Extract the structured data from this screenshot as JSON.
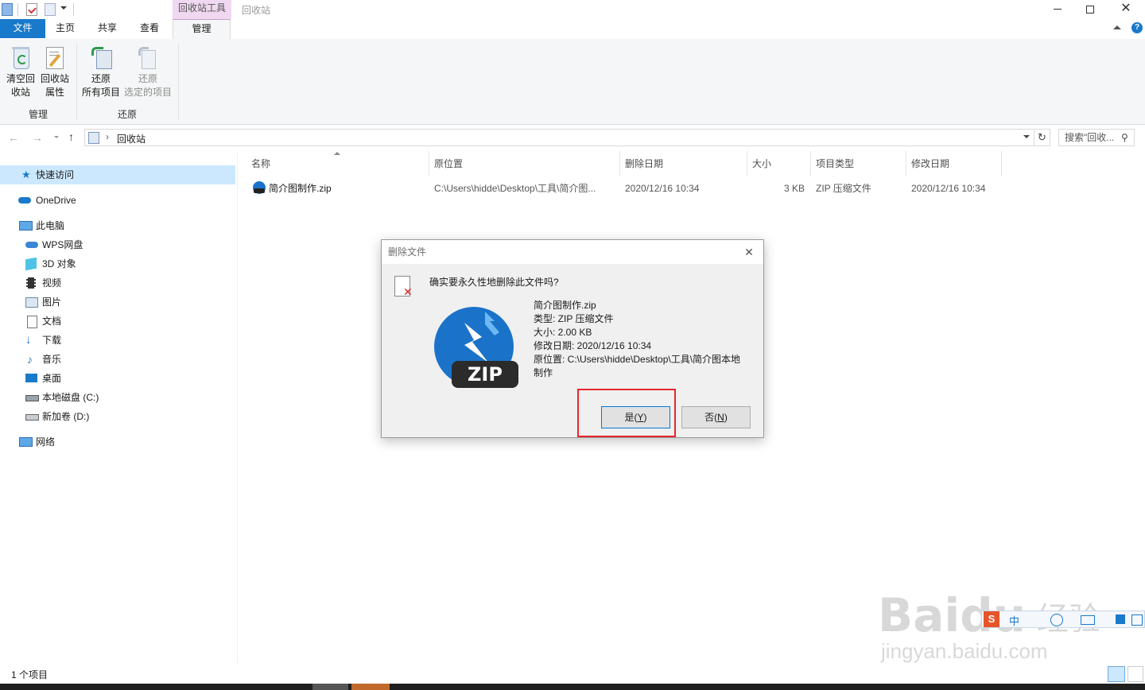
{
  "window": {
    "title": "回收站",
    "context_group": "回收站工具"
  },
  "ribbon": {
    "tabs": [
      "文件",
      "主页",
      "共享",
      "查看",
      "管理"
    ],
    "buttons": {
      "empty_bin": [
        "清空回",
        "收站"
      ],
      "bin_props": [
        "回收站",
        "属性"
      ],
      "restore_all": [
        "还原",
        "所有项目"
      ],
      "restore_selected": [
        "还原",
        "选定的项目"
      ]
    },
    "groups": {
      "manage": "管理",
      "restore": "还原"
    }
  },
  "address": {
    "path": "回收站",
    "search_placeholder": "搜索\"回收..."
  },
  "nav": {
    "quick_access": "快速访问",
    "onedrive": "OneDrive",
    "this_pc": "此电脑",
    "children": [
      "WPS网盘",
      "3D 对象",
      "视频",
      "图片",
      "文档",
      "下载",
      "音乐",
      "桌面",
      "本地磁盘 (C:)",
      "新加卷 (D:)"
    ],
    "network": "网络"
  },
  "list": {
    "columns": [
      "名称",
      "原位置",
      "删除日期",
      "大小",
      "项目类型",
      "修改日期"
    ],
    "rows": [
      {
        "name": "简介图制作.zip",
        "location": "C:\\Users\\hidde\\Desktop\\工具\\简介图...",
        "deleted": "2020/12/16 10:34",
        "size": "3 KB",
        "type": "ZIP 压缩文件",
        "modified": "2020/12/16 10:34"
      }
    ]
  },
  "dialog": {
    "title": "删除文件",
    "question": "确实要永久性地删除此文件吗?",
    "file_name": "简介图制作.zip",
    "type": "类型: ZIP 压缩文件",
    "size": "大小: 2.00 KB",
    "modified": "修改日期: 2020/12/16 10:34",
    "location_line1": "原位置: C:\\Users\\hidde\\Desktop\\工具\\简介图本地",
    "location_line2": "制作",
    "zip_label": "ZIP",
    "yes_prefix": "是(",
    "yes_key": "Y",
    "no_prefix": "否(",
    "no_key": "N",
    "suffix": ")"
  },
  "status": {
    "count": "1 个项目"
  },
  "watermark": {
    "brand": "Baidu",
    "cn": "经验",
    "url": "jingyan.baidu.com"
  },
  "colors": {
    "accent": "#1979ca",
    "context_tab": "#f0d8f0",
    "highlight_border": "#e8262b",
    "selection": "#cce8ff"
  }
}
